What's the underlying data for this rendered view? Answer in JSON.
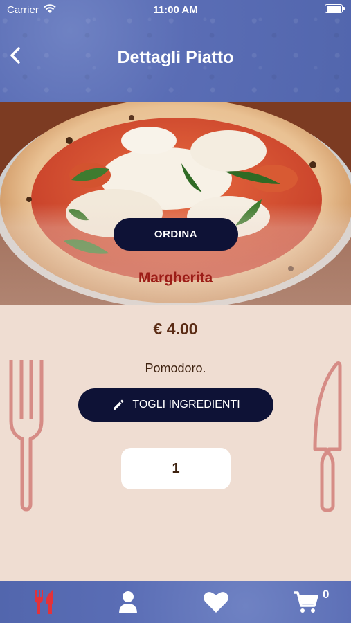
{
  "status_bar": {
    "carrier": "Carrier",
    "time": "11:00 AM"
  },
  "nav": {
    "title": "Dettagli Piatto",
    "back_icon": "chevron-left-icon"
  },
  "dish": {
    "order_label": "ORDINA",
    "name": "Margherita",
    "price": "€ 4.00",
    "description": "Pomodoro.",
    "remove_ingredients_label": "TOGLI INGREDIENTI",
    "quantity": "1"
  },
  "tab_bar": {
    "items": [
      {
        "icon": "fork-knife-icon",
        "active": true
      },
      {
        "icon": "user-icon",
        "active": false
      },
      {
        "icon": "heart-icon",
        "active": false
      },
      {
        "icon": "cart-icon",
        "active": false
      }
    ],
    "cart_count": "0"
  },
  "colors": {
    "header_blue": "#5a6db5",
    "button_navy": "#0e1236",
    "dish_name_red": "#9c1c16",
    "background_beige": "#efddd2",
    "cutlery_pink": "#d68c86",
    "active_tab_red": "#e3323a"
  }
}
